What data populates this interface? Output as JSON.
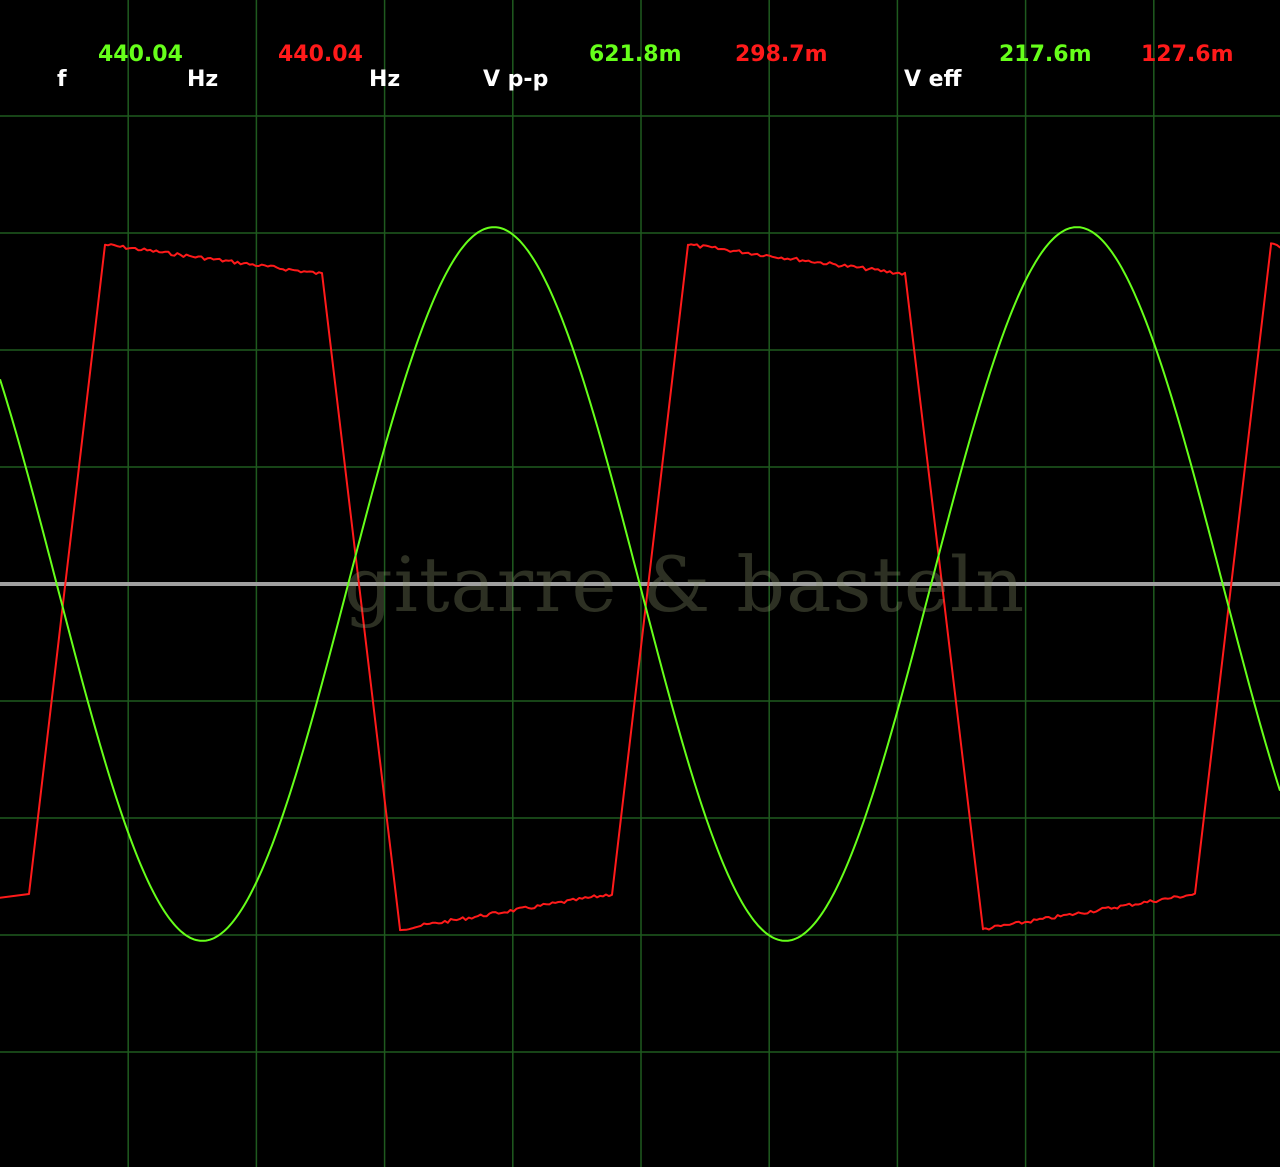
{
  "readouts": {
    "frequency": {
      "label": "f",
      "ch1_value": "440.04",
      "ch1_unit": "Hz",
      "ch2_value": "440.04",
      "ch2_unit": "Hz"
    },
    "vpp": {
      "label": "V p-p",
      "ch1_value": "621.8m",
      "ch2_value": "298.7m"
    },
    "veff": {
      "label": "V eff",
      "ch1_value": "217.6m",
      "ch2_value": "127.6m"
    }
  },
  "watermark": "gitarre & basteln",
  "colors": {
    "background": "#000000",
    "grid": "#1f5a1f",
    "ch1": "#66ff1a",
    "ch2": "#ff1a1a",
    "zero_line": "#a0a0a0",
    "label_text": "#ffffff"
  },
  "chart_data": {
    "type": "line",
    "title": "",
    "xlabel": "",
    "ylabel": "",
    "grid": true,
    "x_divisions": 10,
    "y_divisions": 10,
    "ylim_divisions": [
      -5,
      5
    ],
    "series": [
      {
        "waveform": "sine",
        "color": "#66ff1a",
        "frequency_hz": 440.04,
        "vpp": "621.8m",
        "veff": "217.6m",
        "amplitude_div": 3.05,
        "offset_div": 0.0,
        "cycles_on_screen": 2.2,
        "phase_deg_at_left": 145
      },
      {
        "waveform": "tilted-square",
        "color": "#ff1a1a",
        "frequency_hz": 440.04,
        "vpp": "298.7m",
        "veff": "127.6m",
        "high_div": [
          2.9,
          2.65
        ],
        "low_div": [
          -2.95,
          -2.65
        ],
        "cycles_on_screen": 2.2
      }
    ]
  }
}
